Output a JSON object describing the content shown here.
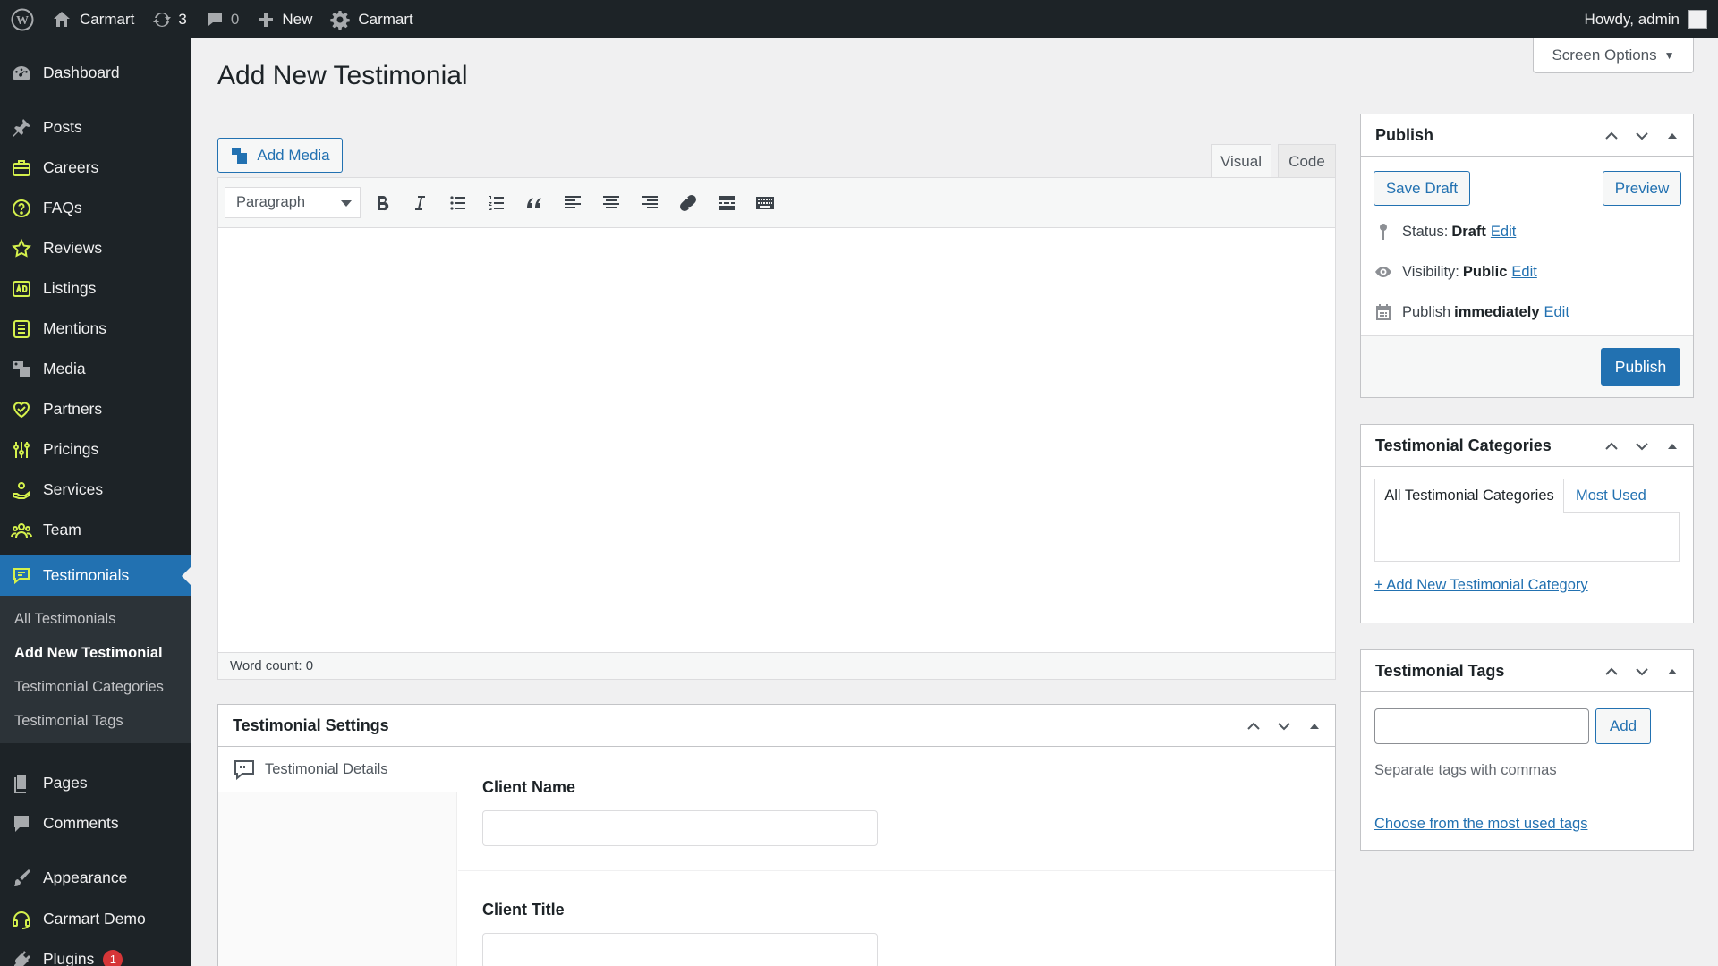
{
  "adminbar": {
    "site_name": "Carmart",
    "updates_count": "3",
    "comments_count": "0",
    "new_label": "New",
    "customize_label": "Carmart",
    "howdy": "Howdy, admin"
  },
  "sidebar": {
    "items": [
      {
        "label": "Dashboard",
        "icon": "dashboard-icon"
      },
      {
        "label": "Posts",
        "icon": "pin-icon"
      },
      {
        "label": "Careers",
        "icon": "briefcase-icon"
      },
      {
        "label": "FAQs",
        "icon": "question-icon"
      },
      {
        "label": "Reviews",
        "icon": "star-icon"
      },
      {
        "label": "Listings",
        "icon": "ad-icon"
      },
      {
        "label": "Mentions",
        "icon": "list-icon"
      },
      {
        "label": "Media",
        "icon": "media-icon"
      },
      {
        "label": "Partners",
        "icon": "heart-handshake-icon"
      },
      {
        "label": "Pricings",
        "icon": "sliders-icon"
      },
      {
        "label": "Services",
        "icon": "hand-coin-icon"
      },
      {
        "label": "Team",
        "icon": "team-icon"
      },
      {
        "label": "Testimonials",
        "icon": "testimonial-icon"
      },
      {
        "label": "Pages",
        "icon": "pages-icon"
      },
      {
        "label": "Comments",
        "icon": "comment-icon"
      },
      {
        "label": "Appearance",
        "icon": "brush-icon"
      },
      {
        "label": "Carmart Demo",
        "icon": "headset-icon"
      },
      {
        "label": "Plugins",
        "icon": "plugin-icon",
        "badge": "1"
      }
    ],
    "submenu": [
      {
        "label": "All Testimonials"
      },
      {
        "label": "Add New Testimonial"
      },
      {
        "label": "Testimonial Categories"
      },
      {
        "label": "Testimonial Tags"
      }
    ]
  },
  "page": {
    "title": "Add New Testimonial",
    "screen_options": "Screen Options"
  },
  "editor": {
    "add_media": "Add Media",
    "tab_visual": "Visual",
    "tab_code": "Code",
    "format_value": "Paragraph",
    "word_count": "Word count: 0"
  },
  "settings": {
    "title": "Testimonial Settings",
    "tab_label": "Testimonial Details",
    "client_name_label": "Client Name",
    "client_title_label": "Client Title"
  },
  "publish": {
    "title": "Publish",
    "save_draft": "Save Draft",
    "preview": "Preview",
    "status_label": "Status:",
    "status_value": "Draft",
    "visibility_label": "Visibility:",
    "visibility_value": "Public",
    "publish_label": "Publish",
    "publish_value": "immediately",
    "edit": "Edit",
    "publish_button": "Publish"
  },
  "categories": {
    "title": "Testimonial Categories",
    "tab_all": "All Testimonial Categories",
    "tab_most_used": "Most Used",
    "add_new": "+ Add New Testimonial Category"
  },
  "tags": {
    "title": "Testimonial Tags",
    "add_button": "Add",
    "hint": "Separate tags with commas",
    "choose_link": "Choose from the most used tags"
  },
  "colors": {
    "adminbar_bg": "#1d2327",
    "accent": "#2271b1",
    "sidebar_icon": "#d4f04c"
  }
}
